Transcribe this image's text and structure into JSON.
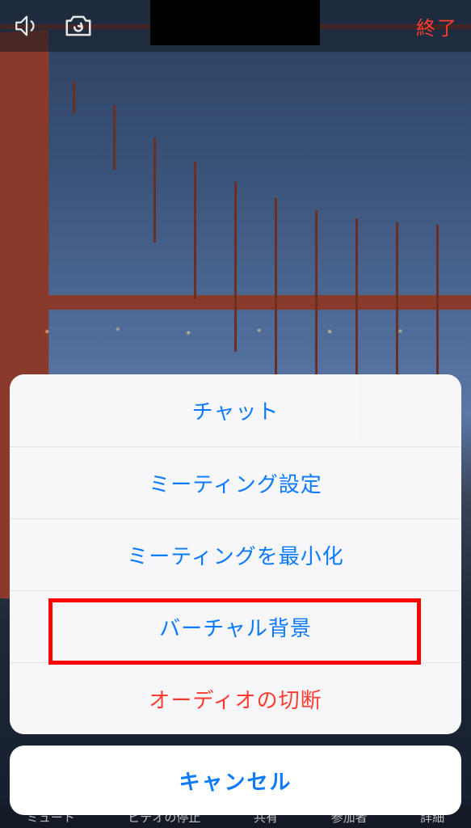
{
  "colors": {
    "accent_blue": "#0a7aff",
    "destructive_red": "#ff3b30",
    "highlight_border": "#ff0000",
    "topbar_icon": "#e6e6e6"
  },
  "topbar": {
    "end_label": "終了"
  },
  "action_sheet": {
    "items": [
      {
        "label": "チャット",
        "destructive": false
      },
      {
        "label": "ミーティング設定",
        "destructive": false
      },
      {
        "label": "ミーティングを最小化",
        "destructive": false
      },
      {
        "label": "バーチャル背景",
        "destructive": false
      },
      {
        "label": "オーディオの切断",
        "destructive": true
      }
    ],
    "cancel_label": "キャンセル",
    "highlighted_index": 3
  },
  "bottom_toolbar_hints": {
    "items": [
      "ミュート",
      "ビデオの停止",
      "共有",
      "参加者",
      "詳細"
    ]
  }
}
